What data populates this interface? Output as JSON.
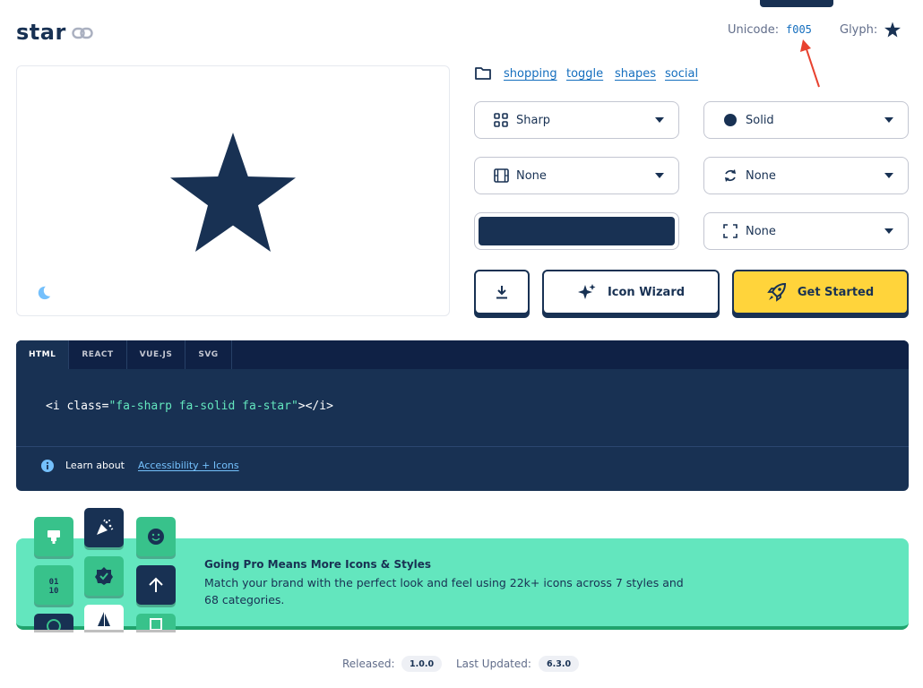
{
  "header": {
    "title": "star",
    "unicode_label": "Unicode:",
    "unicode_value": "f005",
    "glyph_label": "Glyph:"
  },
  "tags": [
    "shopping",
    "toggle",
    "shapes",
    "social"
  ],
  "controls": {
    "family": {
      "label": "Sharp",
      "icon": "grid-icon"
    },
    "style": {
      "label": "Solid",
      "icon": "circle-icon"
    },
    "animation": {
      "label": "None",
      "icon": "film-icon"
    },
    "rotation": {
      "label": "None",
      "icon": "rotate-icon"
    },
    "size": {
      "label": "None",
      "icon": "expand-icon"
    },
    "color": "#183153"
  },
  "actions": {
    "download_icon": "download-icon",
    "wizard_label": "Icon Wizard",
    "started_label": "Get Started"
  },
  "code": {
    "tabs": [
      "HTML",
      "REACT",
      "VUE.JS",
      "SVG"
    ],
    "active_tab": "HTML",
    "line_prefix": "<i class=",
    "line_string": "\"fa-sharp fa-solid fa-star\"",
    "line_suffix": "></i>",
    "learn_label": "Learn about",
    "learn_link": "Accessibility + Icons"
  },
  "pro": {
    "title": "Going Pro Means More Icons & Styles",
    "body": "Match your brand with the perfect look and feel using 22k+ icons across 7 styles and 68 categories."
  },
  "footer": {
    "released_label": "Released:",
    "released_value": "1.0.0",
    "updated_label": "Last Updated:",
    "updated_value": "6.3.0"
  },
  "colors": {
    "navy": "#183153",
    "yellow": "#ffd43b",
    "mint": "#63e6be",
    "link": "#146ebe"
  }
}
